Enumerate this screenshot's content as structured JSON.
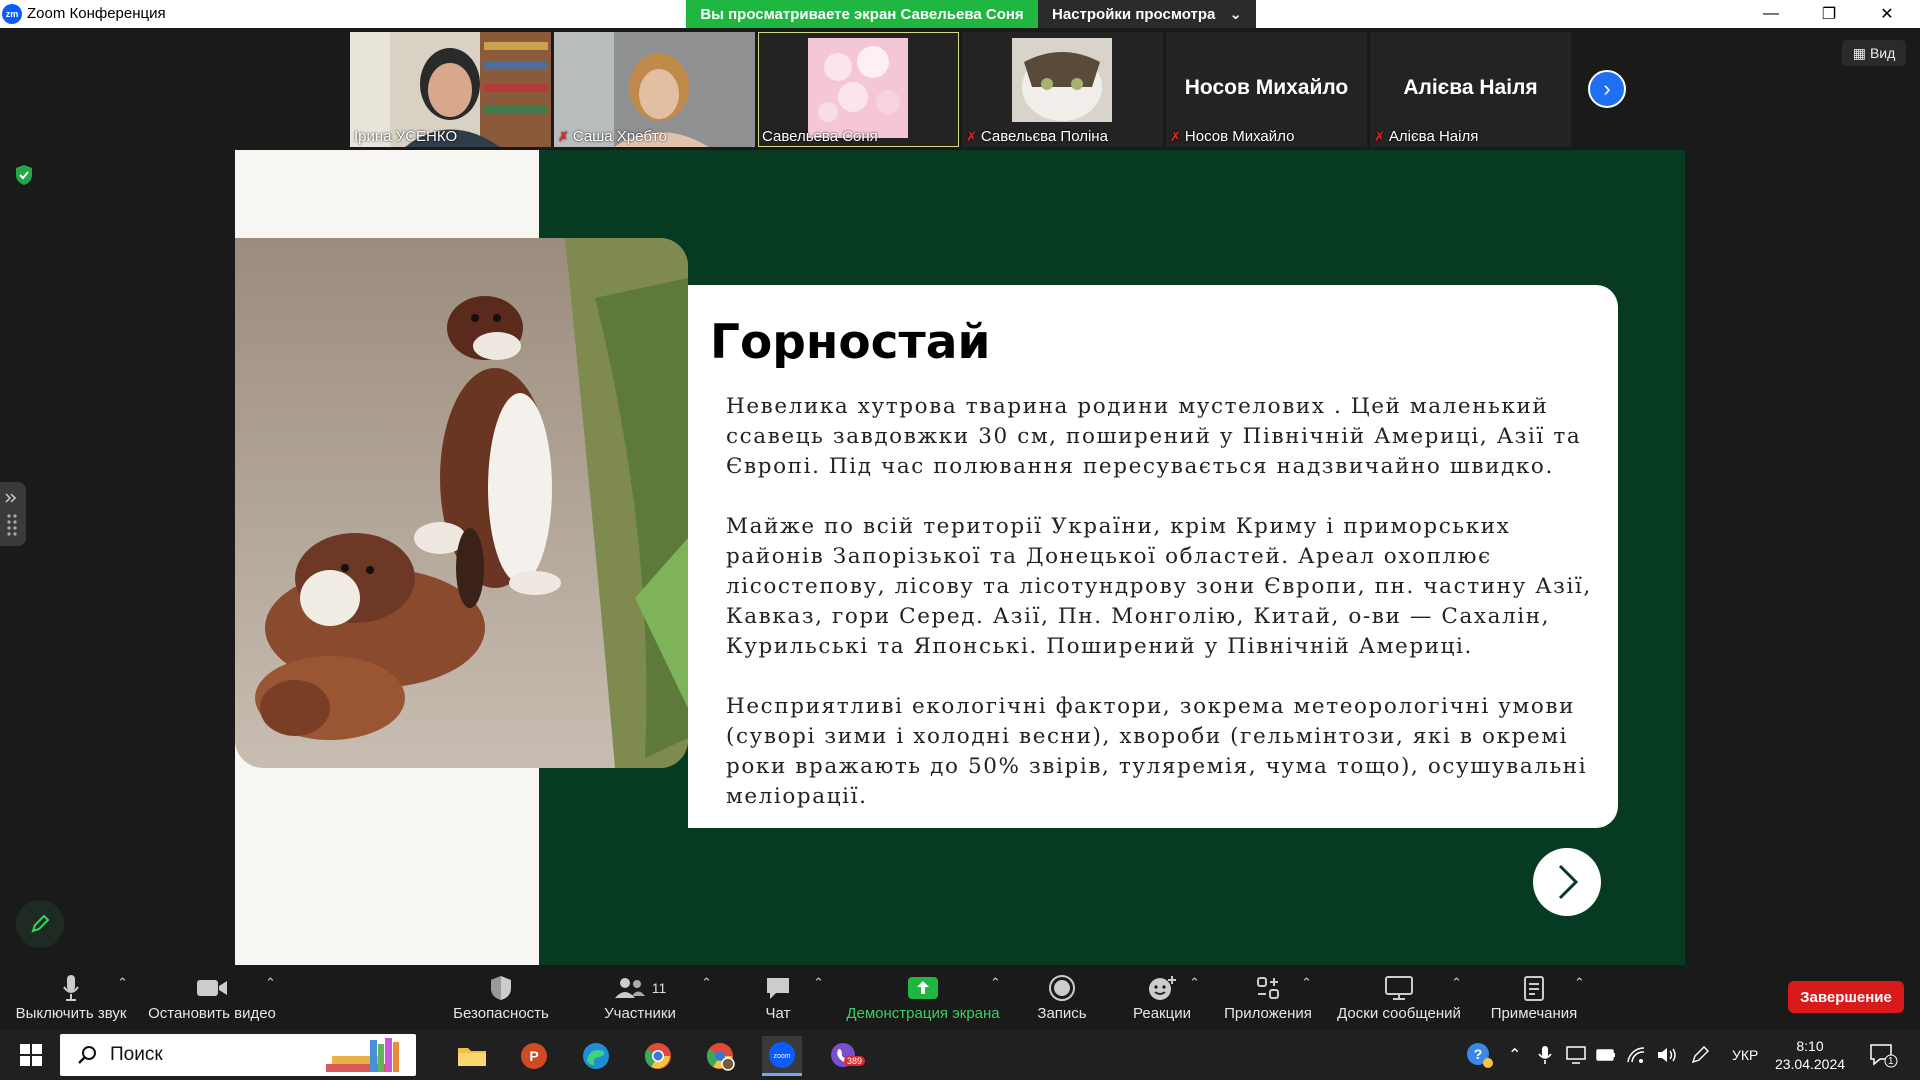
{
  "window": {
    "logo_text": "zm",
    "title": "Zoom Конференция",
    "viewing_banner": "Вы просматриваете экран Савельева Соня",
    "view_settings": "Настройки просмотра",
    "view_button": "Вид"
  },
  "participants": [
    {
      "name": "Ірина УСЕНКО",
      "muted": false,
      "video": true
    },
    {
      "name": "Саша Хребто",
      "muted": true,
      "video": true
    },
    {
      "name": "Савельева Соня",
      "muted": false,
      "video": true
    },
    {
      "name": "Савельєва Поліна",
      "muted": true,
      "video": true
    },
    {
      "name": "Носов Михайло",
      "display_name": "Носов Михайло",
      "muted": true,
      "video": false
    },
    {
      "name": "Алієва Наіля",
      "display_name": "Алієва Наіля",
      "muted": true,
      "video": false
    }
  ],
  "slide": {
    "title": "Горностай",
    "paragraphs": [
      "Невелика хутрова тварина родини мустелових . Цей маленький ссавець завдовжки 30 см, поширений у Північній Америці, Азії та Європі. Під час полювання пересувається надзвичайно швидко.",
      "Майже по всій території України, крім Криму і приморських районів Запорізької та Донецької областей. Ареал охоплює лісостепову, лісову та лісотундрову зони Європи, пн. частину Азії, Кавказ, гори Серед. Азії, Пн. Монголію, Китай, о-ви — Сахалін, Курильські та Японські. Поширений у Північній Америці.",
      "Несприятливі екологічні фактори, зокрема метеорологічні умови (суворі зими і холодні весни), хвороби (гельмінтози, які в окремі роки вражають до 50% звірів, туляремія, чума тощо), осушувальні меліорації."
    ]
  },
  "toolbar": {
    "mute": "Выключить звук",
    "stop_video": "Остановить видео",
    "security": "Безопасность",
    "participants": "Участники",
    "participants_count": "11",
    "chat": "Чат",
    "share_screen": "Демонстрация экрана",
    "record": "Запись",
    "reactions": "Реакции",
    "apps": "Приложения",
    "whiteboards": "Доски сообщений",
    "notes": "Примечания",
    "end": "Завершение"
  },
  "taskbar": {
    "search_placeholder": "Поиск",
    "viber_badge": "389",
    "language": "УКР",
    "time": "8:10",
    "date": "23.04.2024",
    "notification_count": "1"
  },
  "colors": {
    "slide_bg": "#073b21",
    "share_green": "#1fb641",
    "end_red": "#d91a1a",
    "zoom_blue": "#0b5cff"
  }
}
